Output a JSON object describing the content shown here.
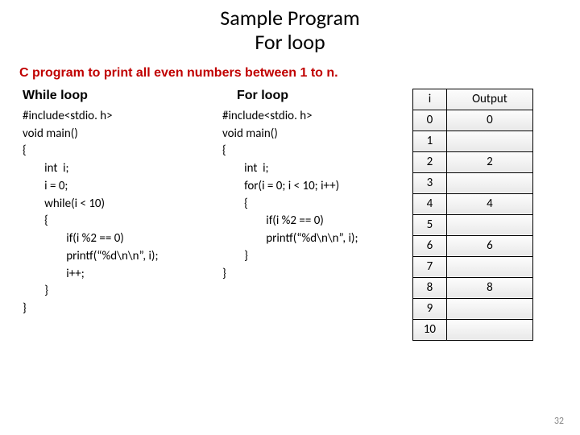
{
  "title_line1": "Sample Program",
  "title_line2": "For loop",
  "subtitle": "C program to print all even numbers between 1 to n.",
  "left": {
    "heading": "While loop",
    "code": "#include<stdio. h>\nvoid main()\n{\n        int  i;\n        i = 0;\n        while(i < 10)\n        {\n                if(i %2 == 0)\n                printf(“%d\\n\\n”, i);\n                i++;\n        }\n}"
  },
  "mid": {
    "heading": "For loop",
    "code": "#include<stdio. h>\nvoid main()\n{\n        int  i;\n        for(i = 0; i < 10; i++)\n        {\n                if(i %2 == 0)\n                printf(“%d\\n\\n”, i);\n        }\n}"
  },
  "table": {
    "head_i": "i",
    "head_out": "Output",
    "rows": [
      {
        "i": "0",
        "out": "0"
      },
      {
        "i": "1",
        "out": ""
      },
      {
        "i": "2",
        "out": "2"
      },
      {
        "i": "3",
        "out": ""
      },
      {
        "i": "4",
        "out": "4"
      },
      {
        "i": "5",
        "out": ""
      },
      {
        "i": "6",
        "out": "6"
      },
      {
        "i": "7",
        "out": ""
      },
      {
        "i": "8",
        "out": "8"
      },
      {
        "i": "9",
        "out": ""
      },
      {
        "i": "10",
        "out": ""
      }
    ]
  },
  "page_number": "32"
}
